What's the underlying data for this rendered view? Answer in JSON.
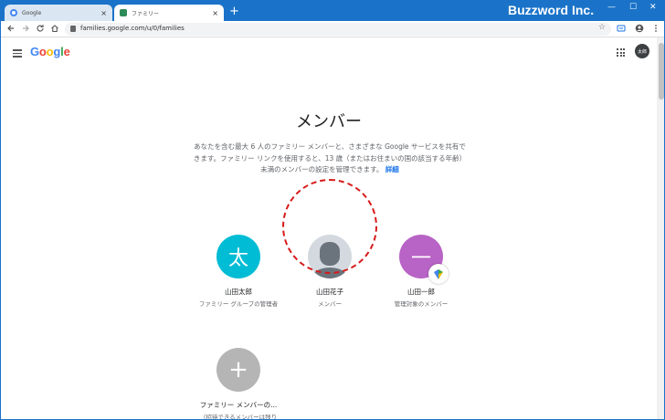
{
  "browser": {
    "tabs": [
      {
        "label": "Google",
        "active": false
      },
      {
        "label": "ファミリー",
        "active": true
      }
    ],
    "new_tab_symbol": "+",
    "close_symbol": "×",
    "brand": "Buzzword Inc.",
    "window_controls": [
      "—",
      "☐",
      "✕"
    ],
    "url": "families.google.com/u/0/families",
    "nav_icons": [
      "back-arrow-icon",
      "forward-arrow-icon",
      "reload-icon",
      "home-icon"
    ],
    "colors": {
      "titlebar": "#1a73c8"
    }
  },
  "header": {
    "logo_text": "Google",
    "account_initials": "太郎"
  },
  "main": {
    "title": "メンバー",
    "description": "あなたを含む最大 6 人のファミリー メンバーと、さまざまな Google サービスを共有できます。ファミリー リンクを使用すると、13 歳（またはお住まいの国の該当する年齢）未満のメンバーの設定を管理できます。",
    "more_link": "詳細",
    "members": [
      {
        "initial": "太",
        "name": "山田太郎",
        "role": "ファミリー グループの管理者",
        "color": "#00bcd4"
      },
      {
        "initial": "",
        "name": "山田花子",
        "role": "メンバー",
        "color": "#d3d9df"
      },
      {
        "initial": "一",
        "name": "山田一郎",
        "role": "管理対象のメンバー",
        "color": "#b863c6"
      }
    ],
    "add_member": {
      "symbol": "+",
      "label": "ファミリー メンバーの...",
      "sub": "（招待できるメンバーは残り"
    }
  }
}
